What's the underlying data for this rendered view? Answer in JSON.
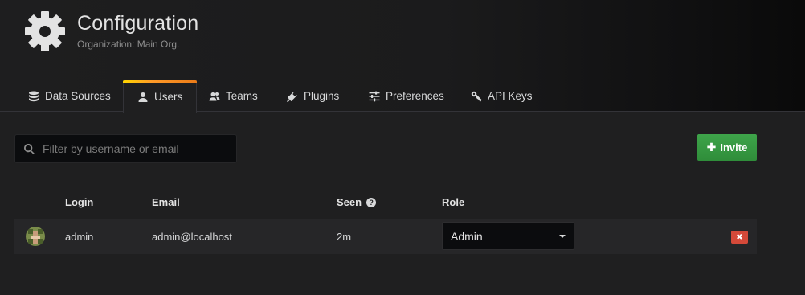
{
  "header": {
    "title": "Configuration",
    "subtitle": "Organization: Main Org.",
    "icon": "gear-icon"
  },
  "tabs": [
    {
      "label": "Data Sources",
      "icon": "database-icon",
      "active": false
    },
    {
      "label": "Users",
      "icon": "user-icon",
      "active": true
    },
    {
      "label": "Teams",
      "icon": "users-icon",
      "active": false
    },
    {
      "label": "Plugins",
      "icon": "plug-icon",
      "active": false
    },
    {
      "label": "Preferences",
      "icon": "sliders-icon",
      "active": false
    },
    {
      "label": "API Keys",
      "icon": "key-icon",
      "active": false
    }
  ],
  "search": {
    "placeholder": "Filter by username or email",
    "value": ""
  },
  "invite_button": {
    "label": "Invite"
  },
  "table": {
    "columns": [
      "",
      "Login",
      "Email",
      "Seen",
      "Role",
      ""
    ],
    "rows": [
      {
        "login": "admin",
        "email": "admin@localhost",
        "seen": "2m",
        "role": "Admin"
      }
    ]
  },
  "colors": {
    "accent_gradient_start": "#ffd500",
    "accent_gradient_end": "#eb7b18",
    "invite_green": "#3ea44a",
    "remove_red": "#d44939"
  }
}
